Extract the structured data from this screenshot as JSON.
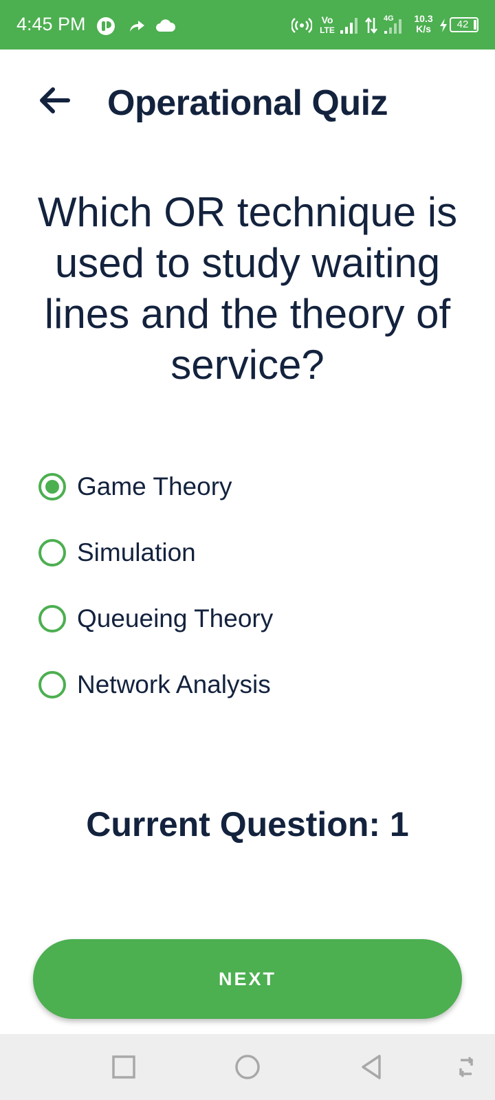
{
  "status_bar": {
    "time": "4:45 PM",
    "network_type": "4G",
    "speed_value": "10.3",
    "speed_unit": "K/s",
    "volte_top": "Vo",
    "volte_bottom": "LTE",
    "battery": "42",
    "icons": [
      "app-notification-icon",
      "forward-arrow-icon",
      "cloud-icon",
      "hotspot-icon",
      "volte-icon",
      "signal-icon",
      "data-transfer-icon",
      "signal-4g-icon",
      "charging-icon",
      "battery-icon"
    ]
  },
  "header": {
    "title": "Operational Quiz",
    "back_icon": "back-arrow-icon"
  },
  "question": {
    "text": "Which OR technique is used to study waiting lines and the theory of service?"
  },
  "options": [
    {
      "label": "Game Theory",
      "selected": true
    },
    {
      "label": "Simulation",
      "selected": false
    },
    {
      "label": "Queueing Theory",
      "selected": false
    },
    {
      "label": "Network Analysis",
      "selected": false
    }
  ],
  "current_question": {
    "text": "Current Question: 1"
  },
  "next_button": {
    "label": "NEXT"
  },
  "nav_bar": {
    "icons": [
      "recent-apps-icon",
      "home-icon",
      "back-icon",
      "rotate-icon"
    ]
  },
  "colors": {
    "accent": "#4caf50",
    "text": "#13223d",
    "nav_bg": "#eeeeee"
  }
}
